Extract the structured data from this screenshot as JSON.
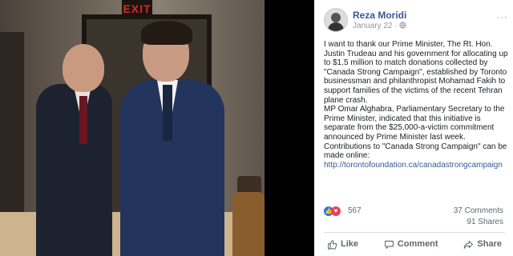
{
  "photo": {
    "exit_sign": "EXIT"
  },
  "post": {
    "author": "Reza Moridi",
    "date": "January 22",
    "privacy_icon": "globe-icon",
    "paragraphs": [
      "I want to thank our Prime Minister, The Rt. Hon. Justin Trudeau and his government for allocating up to $1.5 million to match donations collected by \"Canada Strong Campaign\", established by Toronto businessman and philanthropist Mohamad Fakih to support families of the victims of the recent Tehran plane crash.",
      "MP Omar Alghabra, Parliamentary Secretary to the Prime Minister, indicated that this initiative is separate from the $25,000-a-victim commitment announced by Prime Minister last week.",
      "Contributions to \"Canada Strong Campaign\" can be made online:"
    ],
    "link": "http://torontofoundation.ca/canadastrongcampaign",
    "reactions_count": "567",
    "comments_count": "37 Comments",
    "shares_count": "91 Shares",
    "actions": {
      "like": "Like",
      "comment": "Comment",
      "share": "Share"
    }
  }
}
